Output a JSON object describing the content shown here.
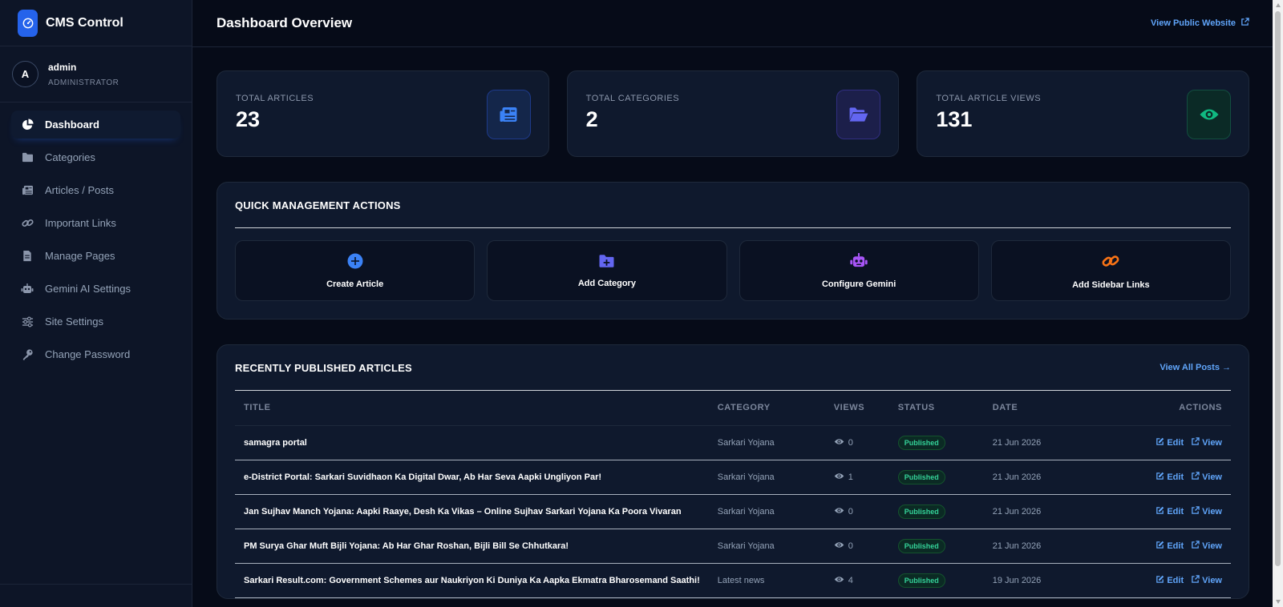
{
  "brand": {
    "title": "CMS Control"
  },
  "user": {
    "initial": "A",
    "name": "admin",
    "role": "ADMINISTRATOR"
  },
  "nav": [
    {
      "label": "Dashboard",
      "icon": "pie-chart-icon",
      "active": true
    },
    {
      "label": "Categories",
      "icon": "folder-icon"
    },
    {
      "label": "Articles / Posts",
      "icon": "newspaper-icon"
    },
    {
      "label": "Important Links",
      "icon": "link-icon"
    },
    {
      "label": "Manage Pages",
      "icon": "file-icon"
    },
    {
      "label": "Gemini AI Settings",
      "icon": "robot-icon"
    },
    {
      "label": "Site Settings",
      "icon": "sliders-icon"
    },
    {
      "label": "Change Password",
      "icon": "key-icon"
    }
  ],
  "header": {
    "title": "Dashboard Overview",
    "public_link": "View Public Website"
  },
  "stats": [
    {
      "label": "TOTAL ARTICLES",
      "value": "23",
      "icon": "newspaper-icon",
      "color": "#3b82f6"
    },
    {
      "label": "TOTAL CATEGORIES",
      "value": "2",
      "icon": "folder-open-icon",
      "color": "#6366f1"
    },
    {
      "label": "TOTAL ARTICLE VIEWS",
      "value": "131",
      "icon": "eye-icon",
      "color": "#10b981"
    }
  ],
  "quick_actions": {
    "title": "QUICK MANAGEMENT ACTIONS",
    "items": [
      {
        "label": "Create Article",
        "icon": "plus-circle-icon",
        "color": "#3b82f6"
      },
      {
        "label": "Add Category",
        "icon": "folder-plus-icon",
        "color": "#6366f1"
      },
      {
        "label": "Configure Gemini",
        "icon": "robot-icon",
        "color": "#a855f7"
      },
      {
        "label": "Add Sidebar Links",
        "icon": "link-icon",
        "color": "#f97316"
      }
    ]
  },
  "recent": {
    "title": "RECENTLY PUBLISHED ARTICLES",
    "view_all": "View All Posts →",
    "columns": [
      "TITLE",
      "CATEGORY",
      "VIEWS",
      "STATUS",
      "DATE",
      "ACTIONS"
    ],
    "edit_label": "Edit",
    "view_label": "View",
    "rows": [
      {
        "title": "samagra portal",
        "category": "Sarkari Yojana",
        "views": "0",
        "status": "Published",
        "date": "21 Jun 2026"
      },
      {
        "title": "e-District Portal: Sarkari Suvidhaon Ka Digital Dwar, Ab Har Seva Aapki Ungliyon Par!",
        "category": "Sarkari Yojana",
        "views": "1",
        "status": "Published",
        "date": "21 Jun 2026"
      },
      {
        "title": "Jan Sujhav Manch Yojana: Aapki Raaye, Desh Ka Vikas – Online Sujhav Sarkari Yojana Ka Poora Vivaran",
        "category": "Sarkari Yojana",
        "views": "0",
        "status": "Published",
        "date": "21 Jun 2026"
      },
      {
        "title": "PM Surya Ghar Muft Bijli Yojana: Ab Har Ghar Roshan, Bijli Bill Se Chhutkara!",
        "category": "Sarkari Yojana",
        "views": "0",
        "status": "Published",
        "date": "21 Jun 2026"
      },
      {
        "title": "Sarkari Result.com: Government Schemes aur Naukriyon Ki Duniya Ka Aapka Ekmatra Bharosemand Saathi!",
        "category": "Latest news",
        "views": "4",
        "status": "Published",
        "date": "19 Jun 2026"
      }
    ]
  }
}
